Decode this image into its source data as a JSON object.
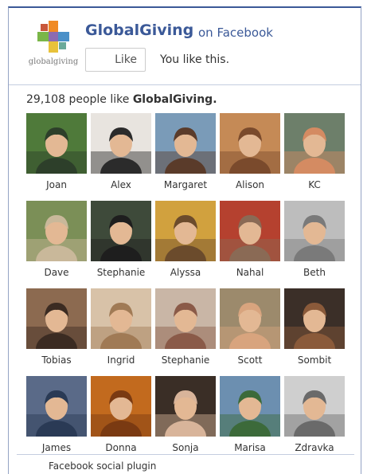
{
  "header": {
    "page_name": "GlobalGiving",
    "on_text": "on Facebook",
    "logo_text": "globalgiving",
    "like_label": "Like",
    "status_text": "You like this."
  },
  "summary": {
    "count": "29,108",
    "text": "people like",
    "page": "GlobalGiving."
  },
  "faces": [
    {
      "name": "Joan",
      "bg": "#4f7a3a",
      "fg": "#2d3f2a"
    },
    {
      "name": "Alex",
      "bg": "#e8e4df",
      "fg": "#2b2b2b"
    },
    {
      "name": "Margaret",
      "bg": "#7a9bb8",
      "fg": "#5a3b2a"
    },
    {
      "name": "Alison",
      "bg": "#c58a56",
      "fg": "#7a4a2c"
    },
    {
      "name": "KC",
      "bg": "#6d7f6a",
      "fg": "#d48b62"
    },
    {
      "name": "Dave",
      "bg": "#7b8f57",
      "fg": "#c9b89a"
    },
    {
      "name": "Stephanie",
      "bg": "#3e4a3a",
      "fg": "#1e1e1e"
    },
    {
      "name": "Alyssa",
      "bg": "#d1a13e",
      "fg": "#6b4b2c"
    },
    {
      "name": "Nahal",
      "bg": "#b5412f",
      "fg": "#8a6a55"
    },
    {
      "name": "Beth",
      "bg": "#bdbdbd",
      "fg": "#7a7a7a"
    },
    {
      "name": "Tobias",
      "bg": "#8c6a50",
      "fg": "#3b2b22"
    },
    {
      "name": "Ingrid",
      "bg": "#d8c2a8",
      "fg": "#a07a55"
    },
    {
      "name": "Stephanie",
      "bg": "#c9b6a6",
      "fg": "#8a5a48"
    },
    {
      "name": "Scott",
      "bg": "#9c8a6c",
      "fg": "#d8a47e"
    },
    {
      "name": "Sombit",
      "bg": "#3b2f28",
      "fg": "#8a5a3a"
    },
    {
      "name": "James",
      "bg": "#5a6a88",
      "fg": "#2a3a55"
    },
    {
      "name": "Donna",
      "bg": "#c26a1e",
      "fg": "#7a3a12"
    },
    {
      "name": "Sonja",
      "bg": "#3a2e26",
      "fg": "#d8b49a"
    },
    {
      "name": "Marisa",
      "bg": "#6c8fb0",
      "fg": "#3c6a3a"
    },
    {
      "name": "Zdravka",
      "bg": "#cfcfcf",
      "fg": "#6a6a6a"
    }
  ],
  "footer": {
    "text": "Facebook social plugin"
  },
  "colors": {
    "facebook_blue": "#3b5998",
    "border": "#94a3c4"
  }
}
